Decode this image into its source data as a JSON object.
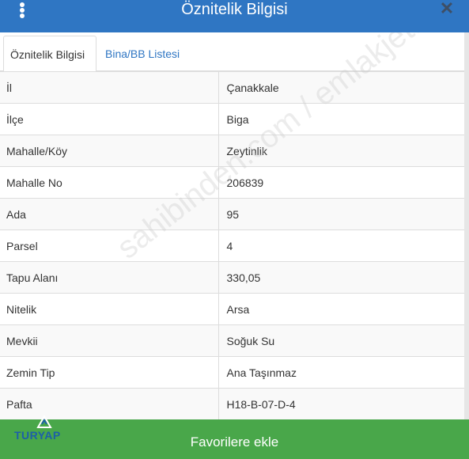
{
  "header": {
    "title": "Öznitelik Bilgisi",
    "close_label": "✕"
  },
  "tabs": [
    {
      "label": "Öznitelik Bilgisi",
      "active": true
    },
    {
      "label": "Bina/BB Listesi",
      "active": false
    }
  ],
  "rows": [
    {
      "key": "İl",
      "value": "Çanakkale"
    },
    {
      "key": "İlçe",
      "value": "Biga"
    },
    {
      "key": "Mahalle/Köy",
      "value": "Zeytinlik"
    },
    {
      "key": "Mahalle No",
      "value": "206839"
    },
    {
      "key": "Ada",
      "value": "95"
    },
    {
      "key": "Parsel",
      "value": "4"
    },
    {
      "key": "Tapu Alanı",
      "value": "330,05"
    },
    {
      "key": "Nitelik",
      "value": "Arsa"
    },
    {
      "key": "Mevkii",
      "value": "Soğuk Su"
    },
    {
      "key": "Zemin Tip",
      "value": "Ana Taşınmaz"
    },
    {
      "key": "Pafta",
      "value": "H18-B-07-D-4"
    }
  ],
  "watermark": "sahibinden.com / emlakjet.com",
  "footer": {
    "button_label": "Favorilere ekle"
  },
  "logo": {
    "text": "TURYAP"
  },
  "colors": {
    "header": "#2f76c3",
    "footer": "#49a74a",
    "tab_link": "#2f76c3"
  }
}
